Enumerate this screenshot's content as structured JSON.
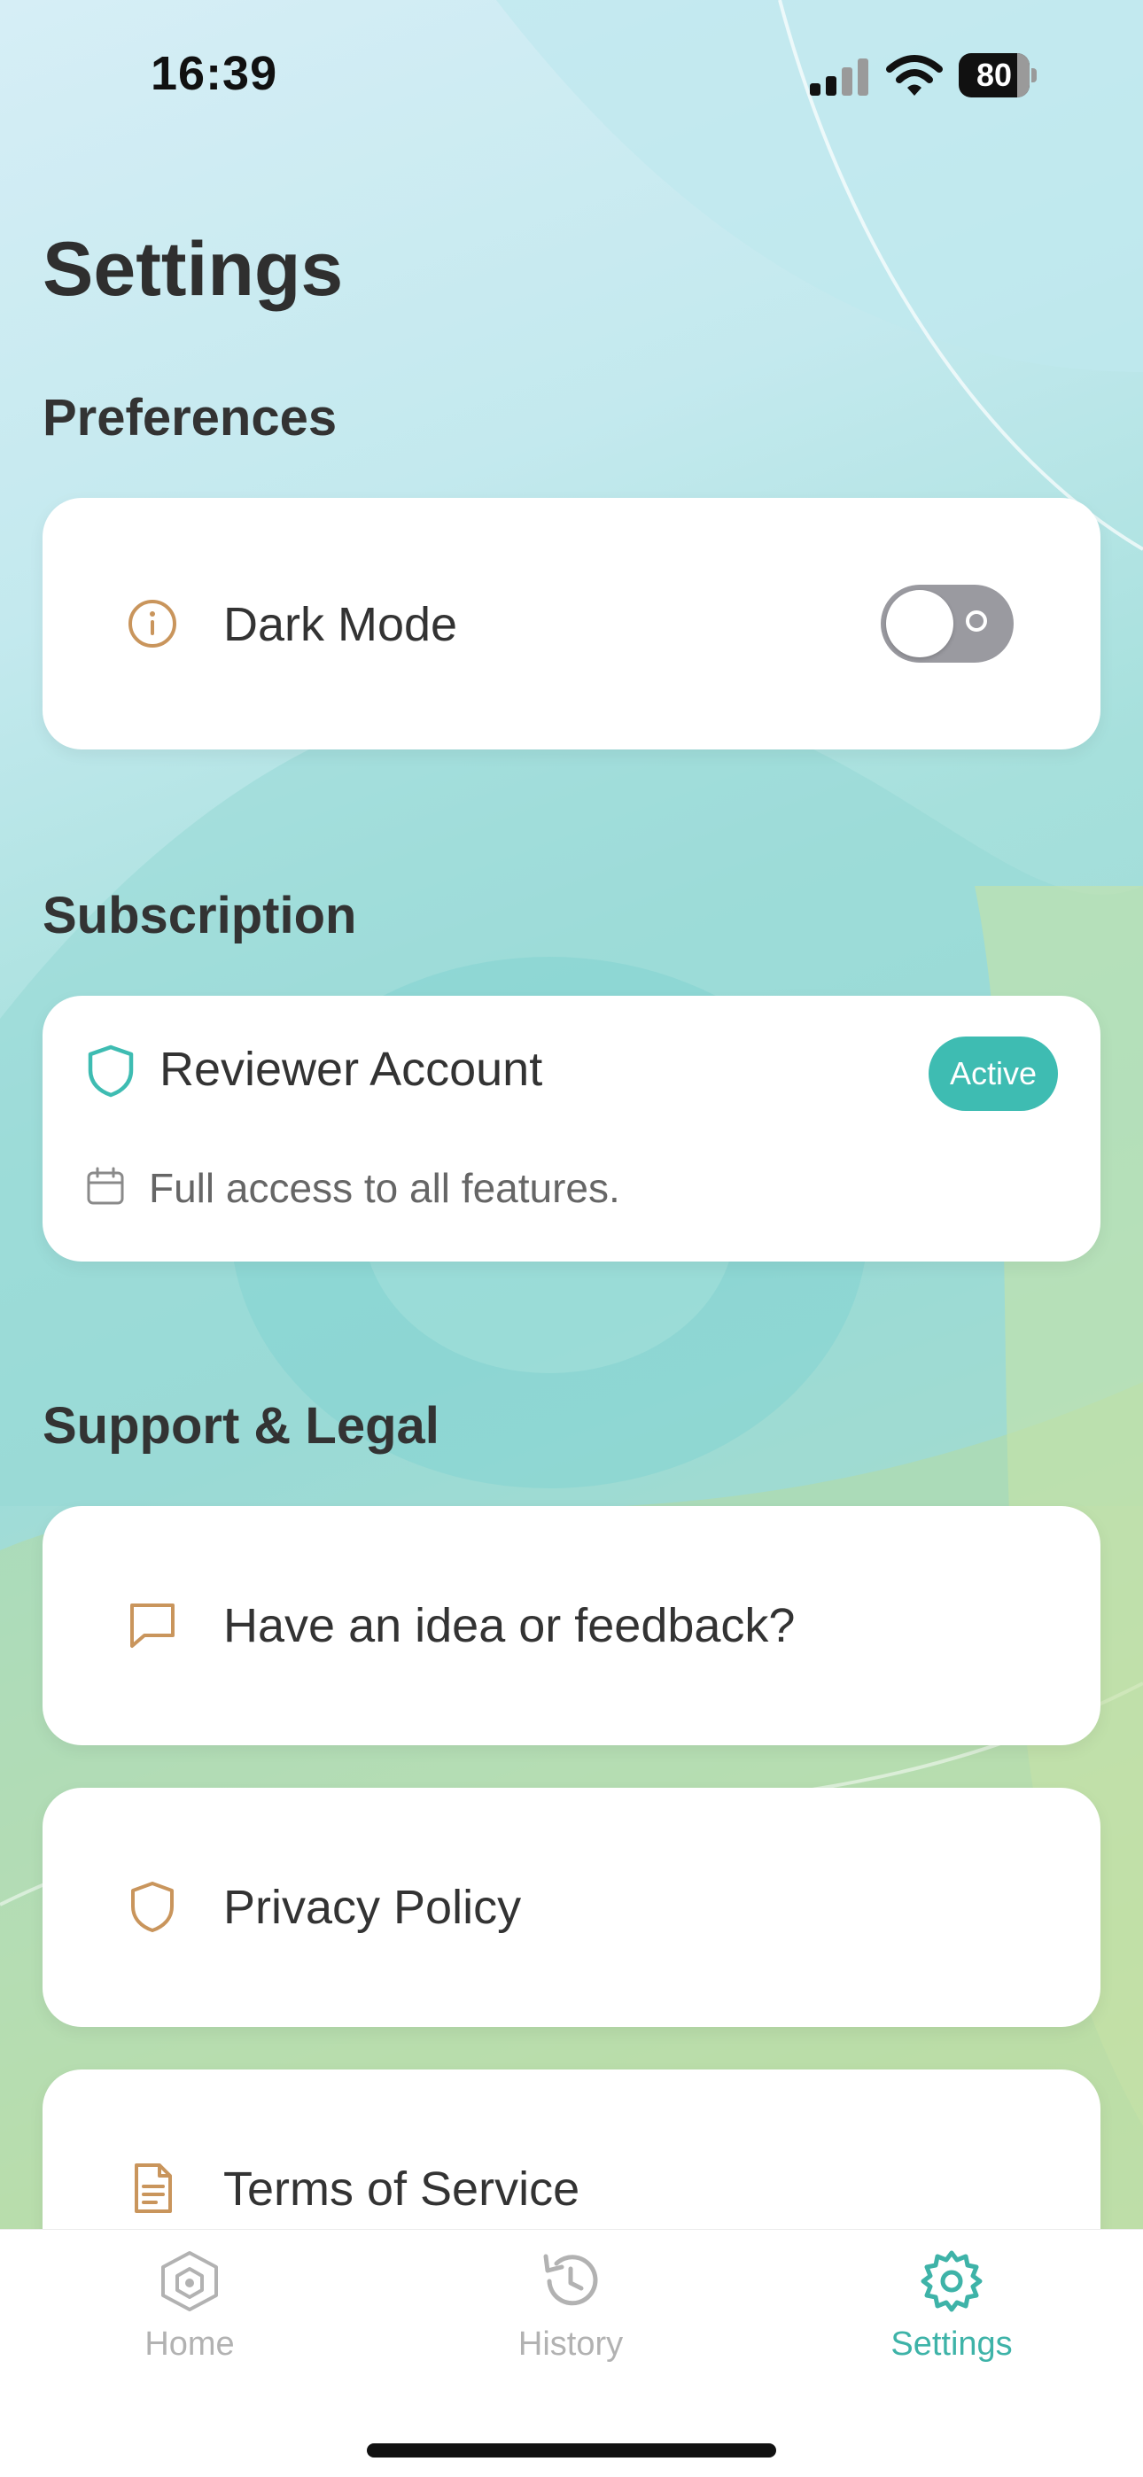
{
  "status_bar": {
    "time": "16:39",
    "battery": "80"
  },
  "page": {
    "title": "Settings"
  },
  "sections": {
    "preferences": "Preferences",
    "subscription": "Subscription",
    "support": "Support & Legal"
  },
  "preferences": {
    "dark_mode_label": "Dark Mode",
    "dark_mode_enabled": false,
    "dark_mode_icon": "info-icon"
  },
  "subscription": {
    "account_label": "Reviewer Account",
    "account_icon": "shield-icon",
    "status_badge": "Active",
    "description": "Full access to all features.",
    "description_icon": "calendar-icon"
  },
  "support_items": [
    {
      "label": "Have an idea or feedback?",
      "icon": "chat-bubble-icon"
    },
    {
      "label": "Privacy Policy",
      "icon": "shield-icon"
    },
    {
      "label": "Terms of Service",
      "icon": "document-icon"
    }
  ],
  "tabs": [
    {
      "label": "Home",
      "icon": "home-icon",
      "active": false
    },
    {
      "label": "History",
      "icon": "history-icon",
      "active": false
    },
    {
      "label": "Settings",
      "icon": "gear-icon",
      "active": true
    }
  ],
  "colors": {
    "accent": "#3ebcb2",
    "icon_tan": "#c9955c",
    "tab_inactive": "#b2b2b2",
    "card_bg": "#ffffff",
    "toggle_off": "#9a9aa0"
  }
}
